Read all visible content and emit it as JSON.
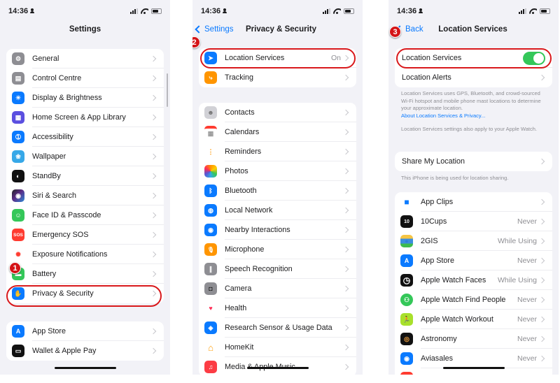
{
  "status_bar": {
    "time": "14:36"
  },
  "screen1": {
    "title": "Settings",
    "group1": [
      {
        "label": "General",
        "icon": "gear-icon",
        "glyph": "⚙"
      },
      {
        "label": "Control Centre",
        "icon": "control-centre-icon",
        "glyph": "▤"
      },
      {
        "label": "Display & Brightness",
        "icon": "sun-icon",
        "glyph": "☀"
      },
      {
        "label": "Home Screen & App Library",
        "icon": "home-screen-icon",
        "glyph": "▦"
      },
      {
        "label": "Accessibility",
        "icon": "accessibility-icon",
        "glyph": "➀"
      },
      {
        "label": "Wallpaper",
        "icon": "flower-icon",
        "glyph": "❀"
      },
      {
        "label": "StandBy",
        "icon": "standby-icon",
        "glyph": "◐"
      },
      {
        "label": "Siri & Search",
        "icon": "siri-icon",
        "glyph": "◉"
      },
      {
        "label": "Face ID & Passcode",
        "icon": "face-id-icon",
        "glyph": "☺"
      },
      {
        "label": "Emergency SOS",
        "icon": "sos-icon",
        "glyph": "SOS"
      },
      {
        "label": "Exposure Notifications",
        "icon": "exposure-icon",
        "glyph": "✺"
      },
      {
        "label": "Battery",
        "icon": "battery-icon",
        "glyph": "▬"
      },
      {
        "label": "Privacy & Security",
        "icon": "hand-icon",
        "glyph": "✋"
      }
    ],
    "group2": [
      {
        "label": "App Store",
        "icon": "app-store-icon",
        "glyph": "A"
      },
      {
        "label": "Wallet & Apple Pay",
        "icon": "wallet-icon",
        "glyph": "▭"
      }
    ],
    "step_badge": "1"
  },
  "screen2": {
    "back_label": "Settings",
    "title": "Privacy & Security",
    "group1": [
      {
        "label": "Location Services",
        "value": "On",
        "icon": "location-arrow-icon",
        "glyph": "➤"
      },
      {
        "label": "Tracking",
        "value": "",
        "icon": "tracking-icon",
        "glyph": "⤷"
      }
    ],
    "group2": [
      {
        "label": "Contacts",
        "icon": "contacts-icon",
        "glyph": "☻"
      },
      {
        "label": "Calendars",
        "icon": "calendar-icon",
        "glyph": "▦"
      },
      {
        "label": "Reminders",
        "icon": "reminders-icon",
        "glyph": "⋮"
      },
      {
        "label": "Photos",
        "icon": "photos-icon",
        "glyph": ""
      },
      {
        "label": "Bluetooth",
        "icon": "bluetooth-icon",
        "glyph": "ᛒ"
      },
      {
        "label": "Local Network",
        "icon": "globe-icon",
        "glyph": "◍"
      },
      {
        "label": "Nearby Interactions",
        "icon": "nearby-icon",
        "glyph": "◉"
      },
      {
        "label": "Microphone",
        "icon": "microphone-icon",
        "glyph": "🎙"
      },
      {
        "label": "Speech Recognition",
        "icon": "waveform-icon",
        "glyph": "∥"
      },
      {
        "label": "Camera",
        "icon": "camera-icon",
        "glyph": "◘"
      },
      {
        "label": "Health",
        "icon": "heart-icon",
        "glyph": "♥"
      },
      {
        "label": "Research Sensor & Usage Data",
        "icon": "research-icon",
        "glyph": "◈"
      },
      {
        "label": "HomeKit",
        "icon": "home-icon",
        "glyph": "⌂"
      },
      {
        "label": "Media & Apple Music",
        "icon": "music-icon",
        "glyph": "♫"
      }
    ],
    "step_badge": "2"
  },
  "screen3": {
    "back_label": "Back",
    "title": "Location Services",
    "toggle_row": {
      "label": "Location Services",
      "on": true
    },
    "alerts_row": {
      "label": "Location Alerts"
    },
    "footer1": "Location Services uses GPS, Bluetooth, and crowd-sourced Wi-Fi hotspot and mobile phone mast locations to determine your approximate location.",
    "footer1_link": "About Location Services & Privacy...",
    "footer2": "Location Services settings also apply to your Apple Watch.",
    "share_row": {
      "label": "Share My Location"
    },
    "share_footer": "This iPhone is being used for location sharing.",
    "apps": [
      {
        "label": "App Clips",
        "value": "",
        "icon": "app-clips-icon",
        "glyph": "■"
      },
      {
        "label": "10Cups",
        "value": "Never",
        "icon": "10cups-icon",
        "glyph": "10"
      },
      {
        "label": "2GIS",
        "value": "While Using",
        "icon": "2gis-icon",
        "glyph": "●"
      },
      {
        "label": "App Store",
        "value": "Never",
        "icon": "app-store-icon",
        "glyph": "A"
      },
      {
        "label": "Apple Watch Faces",
        "value": "While Using",
        "icon": "watch-faces-icon",
        "glyph": "◷"
      },
      {
        "label": "Apple Watch Find People",
        "value": "Never",
        "icon": "find-people-icon",
        "glyph": "⚇"
      },
      {
        "label": "Apple Watch Workout",
        "value": "Never",
        "icon": "workout-icon",
        "glyph": "🏃"
      },
      {
        "label": "Astronomy",
        "value": "Never",
        "icon": "astronomy-icon",
        "glyph": "◎"
      },
      {
        "label": "Aviasales",
        "value": "Never",
        "icon": "aviasales-icon",
        "glyph": "◉"
      }
    ],
    "step_badge": "3"
  }
}
